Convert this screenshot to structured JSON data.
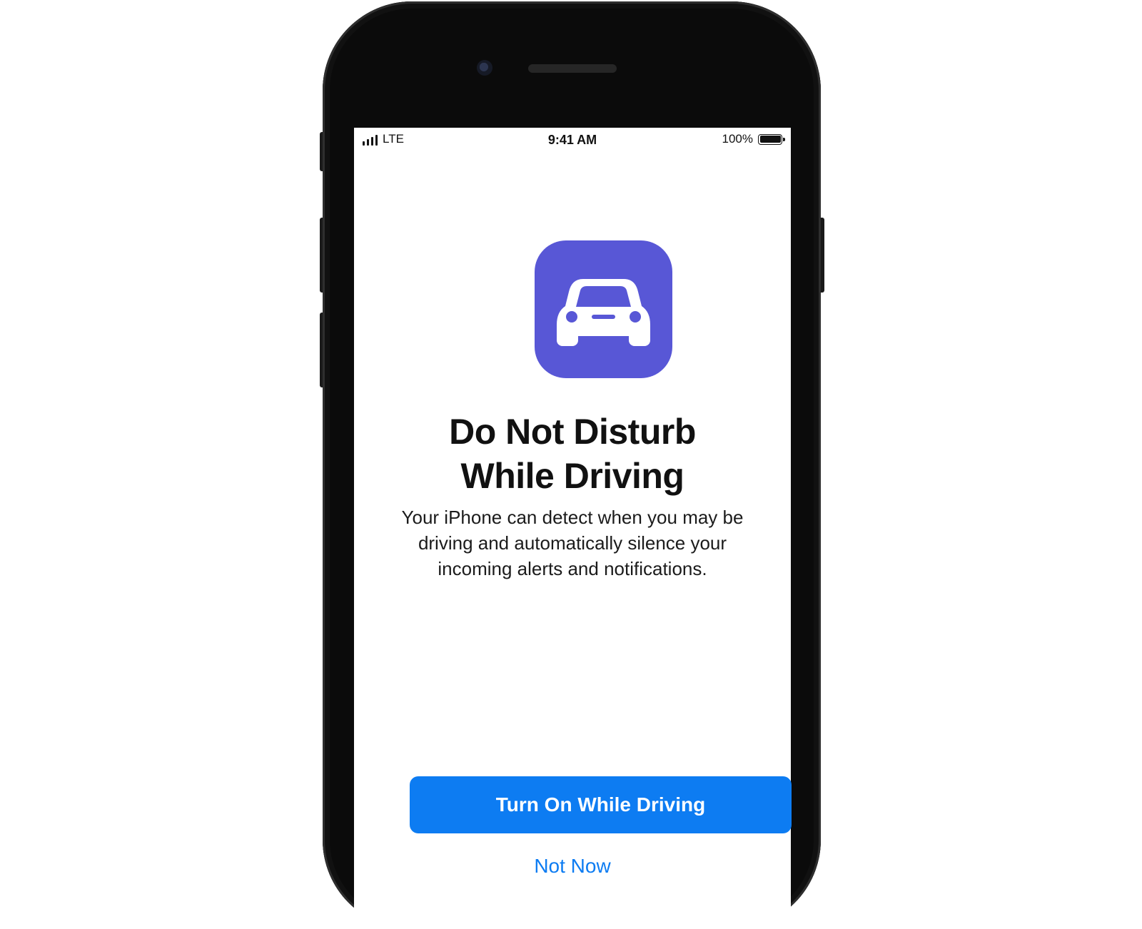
{
  "status_bar": {
    "carrier": "LTE",
    "time": "9:41 AM",
    "battery_percent": "100%"
  },
  "app_icon": {
    "icon": "car-icon",
    "background_color": "#5857d6"
  },
  "title": "Do Not Disturb\nWhile Driving",
  "description": "Your iPhone can detect when you may be driving and automatically silence your incoming alerts and notifications.",
  "actions": {
    "primary_label": "Turn On While Driving",
    "secondary_label": "Not Now",
    "accent_color": "#0d7cf2"
  }
}
